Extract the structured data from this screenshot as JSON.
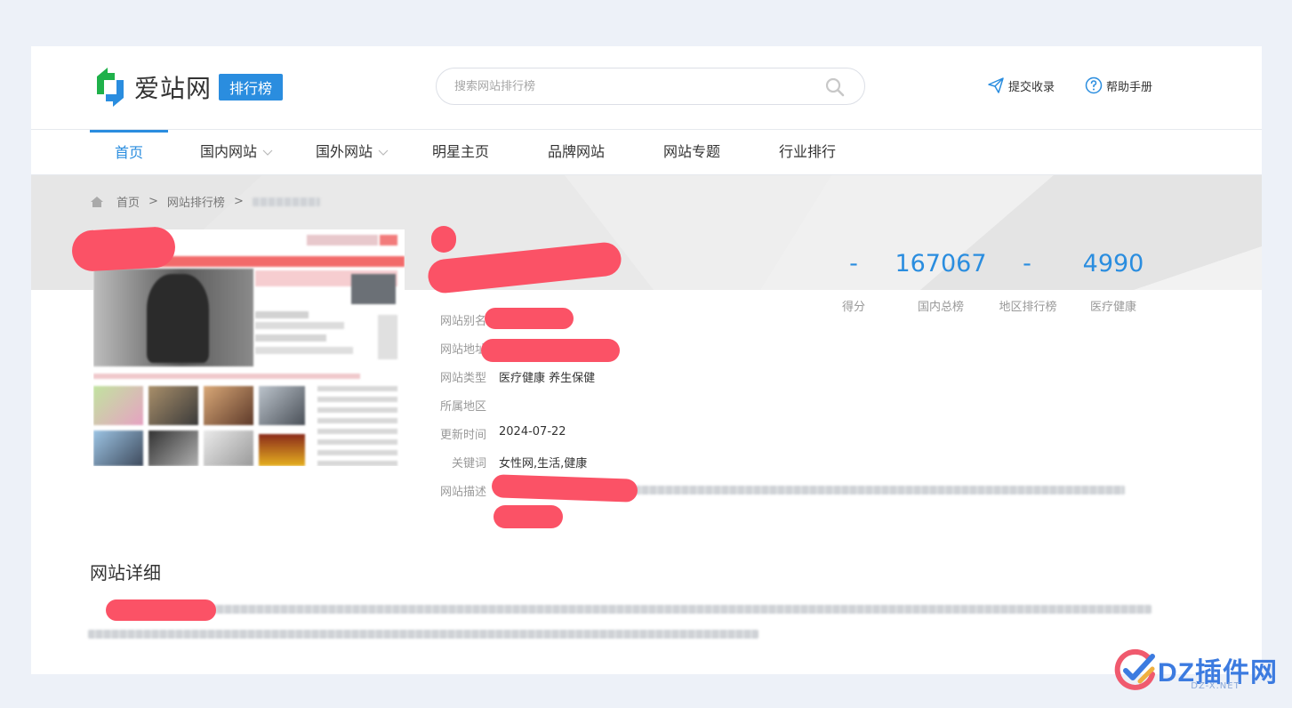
{
  "brand": {
    "name": "爱站网",
    "badge": "排行榜"
  },
  "search": {
    "placeholder": "搜索网站排行榜"
  },
  "header_links": {
    "submit": "提交收录",
    "help": "帮助手册"
  },
  "nav": [
    {
      "label": "首页",
      "active": true
    },
    {
      "label": "国内网站",
      "dropdown": true
    },
    {
      "label": "国外网站",
      "dropdown": true
    },
    {
      "label": "明星主页"
    },
    {
      "label": "品牌网站"
    },
    {
      "label": "网站专题"
    },
    {
      "label": "行业排行"
    }
  ],
  "breadcrumb": {
    "home": "首页",
    "sep": ">",
    "list": "网站排行榜"
  },
  "stats": [
    {
      "value": "-",
      "label": "得分"
    },
    {
      "value": "167067",
      "label": "国内总榜"
    },
    {
      "value": "-",
      "label": "地区排行榜"
    },
    {
      "value": "4990",
      "label": "医疗健康"
    }
  ],
  "info": {
    "alias": {
      "label": "网站别名",
      "value": ""
    },
    "url": {
      "label": "网站地址",
      "value": ""
    },
    "type": {
      "label": "网站类型",
      "value": "医疗健康 养生保健"
    },
    "region": {
      "label": "所属地区",
      "value": ""
    },
    "updated": {
      "label": "更新时间",
      "value": "2024-07-22"
    },
    "keywords": {
      "label": "关键词",
      "value": "女性网,生活,健康"
    },
    "desc": {
      "label": "网站描述",
      "value": ""
    }
  },
  "details": {
    "title": "网站详细"
  },
  "watermark": {
    "brand": "DZ插件网",
    "url": "DZ-X.NET"
  },
  "colors": {
    "accent": "#2a8ddf",
    "redaction": "#fb5266",
    "page_bg": "#edf1f8"
  }
}
